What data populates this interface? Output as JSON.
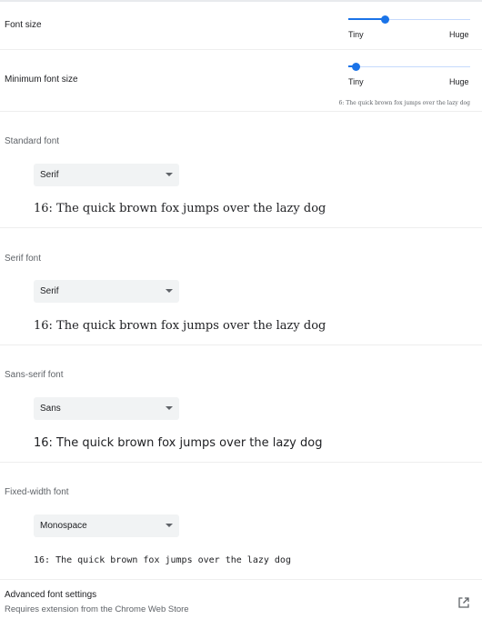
{
  "font_size": {
    "label": "Font size",
    "min_label": "Tiny",
    "max_label": "Huge",
    "value_fraction": 0.3
  },
  "minimum_font_size": {
    "label": "Minimum font size",
    "min_label": "Tiny",
    "max_label": "Huge",
    "value_fraction": 0.06,
    "preview": "6: The quick brown fox jumps over the lazy dog"
  },
  "fonts": [
    {
      "label": "Standard font",
      "selected": "Serif",
      "preview": "16: The quick brown fox jumps over the lazy dog"
    },
    {
      "label": "Serif font",
      "selected": "Serif",
      "preview": "16: The quick brown fox jumps over the lazy dog"
    },
    {
      "label": "Sans-serif font",
      "selected": "Sans",
      "preview": "16: The quick brown fox jumps over the lazy dog"
    },
    {
      "label": "Fixed-width font",
      "selected": "Monospace",
      "preview": "16: The quick brown fox jumps over the lazy dog"
    }
  ],
  "advanced": {
    "title": "Advanced font settings",
    "subtitle": "Requires extension from the Chrome Web Store",
    "icon": "external-link-icon"
  },
  "colors": {
    "accent": "#1a73e8",
    "track": "#c6dafc",
    "select_bg": "#f1f3f4"
  }
}
